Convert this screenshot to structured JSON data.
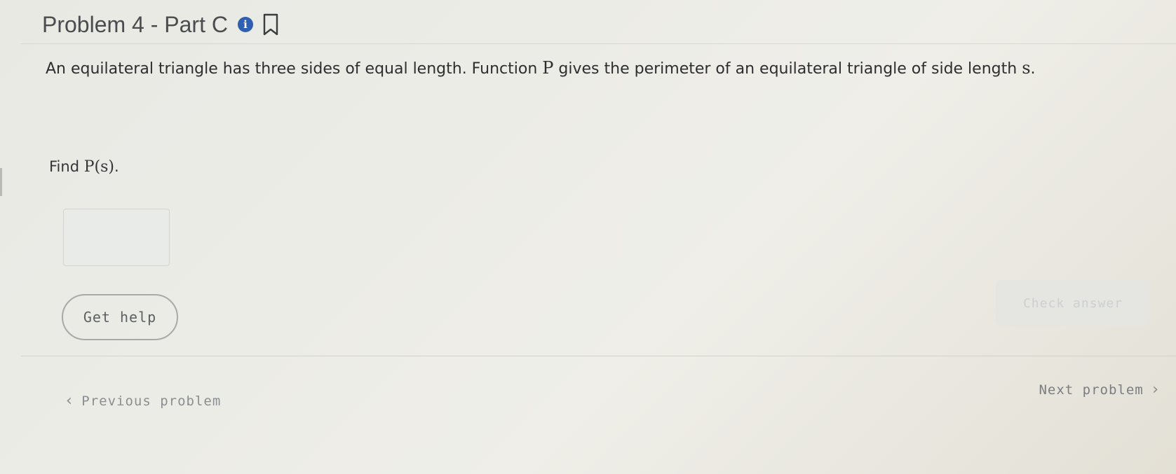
{
  "header": {
    "title": "Problem 4 - Part C",
    "info_icon_glyph": "i",
    "info_color": "#2e5fb0"
  },
  "problem": {
    "part1": "An equilateral triangle has three sides of equal length. Function ",
    "var_p": "P",
    "part2": " gives the perimeter of an equilateral triangle of side length ",
    "var_s": "s",
    "part3": "."
  },
  "find": {
    "label": "Find ",
    "math": "P(s)",
    "end": "."
  },
  "answer": {
    "value": ""
  },
  "buttons": {
    "get_help": "Get help",
    "check_answer": "Check answer"
  },
  "nav": {
    "prev_chevron": "‹",
    "prev_label": "Previous problem",
    "next_label": "Next problem",
    "next_chevron": "›"
  }
}
